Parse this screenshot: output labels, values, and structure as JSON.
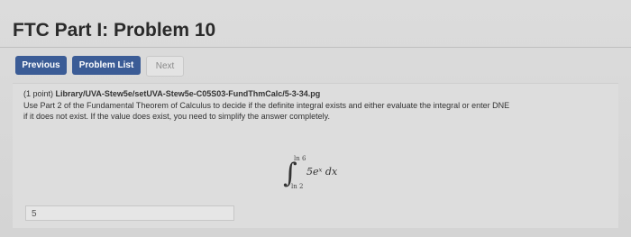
{
  "title": "FTC Part I: Problem 10",
  "nav": {
    "previous": "Previous",
    "problem_list": "Problem List",
    "next": "Next"
  },
  "problem": {
    "points_prefix": "(1 point)",
    "path": "Library/UVA-Stew5e/setUVA-Stew5e-C05S03-FundThmCalc/5-3-34.pg",
    "instruction_1": "Use Part 2 of the Fundamental Theorem of Calculus to decide if the definite integral exists and either evaluate the integral or enter DNE",
    "instruction_2": "if it does not exist. If the value does exist, you need to simplify the answer completely.",
    "integral": {
      "upper": "ln 6",
      "lower": "ln 2",
      "integrand": "5eˣ dx"
    },
    "answer_value": "5"
  }
}
